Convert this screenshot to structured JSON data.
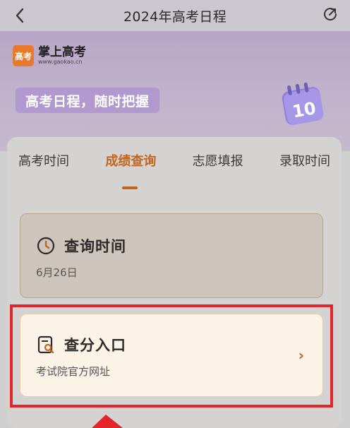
{
  "header": {
    "title": "2024年高考日程",
    "back_icon": "chevron-left-icon",
    "share_icon": "share-icon"
  },
  "brand": {
    "name": "掌上高考",
    "url": "www.gaokao.cn",
    "badge_text": "高考"
  },
  "hero": {
    "slogan": "高考日程，随时把握",
    "calendar_day": "10"
  },
  "tabs": [
    {
      "label": "高考时间",
      "active": false
    },
    {
      "label": "成绩查询",
      "active": true
    },
    {
      "label": "志愿填报",
      "active": false
    },
    {
      "label": "录取时间",
      "active": false
    }
  ],
  "items": [
    {
      "title": "查询时间",
      "subtitle": "6月26日",
      "icon": "clock-icon"
    },
    {
      "title": "查分入口",
      "subtitle": "考试院官方网址",
      "icon": "search-document-icon",
      "chevron": "›"
    }
  ],
  "colors": {
    "accent": "#c2651e",
    "highlight": "#e3262c"
  }
}
